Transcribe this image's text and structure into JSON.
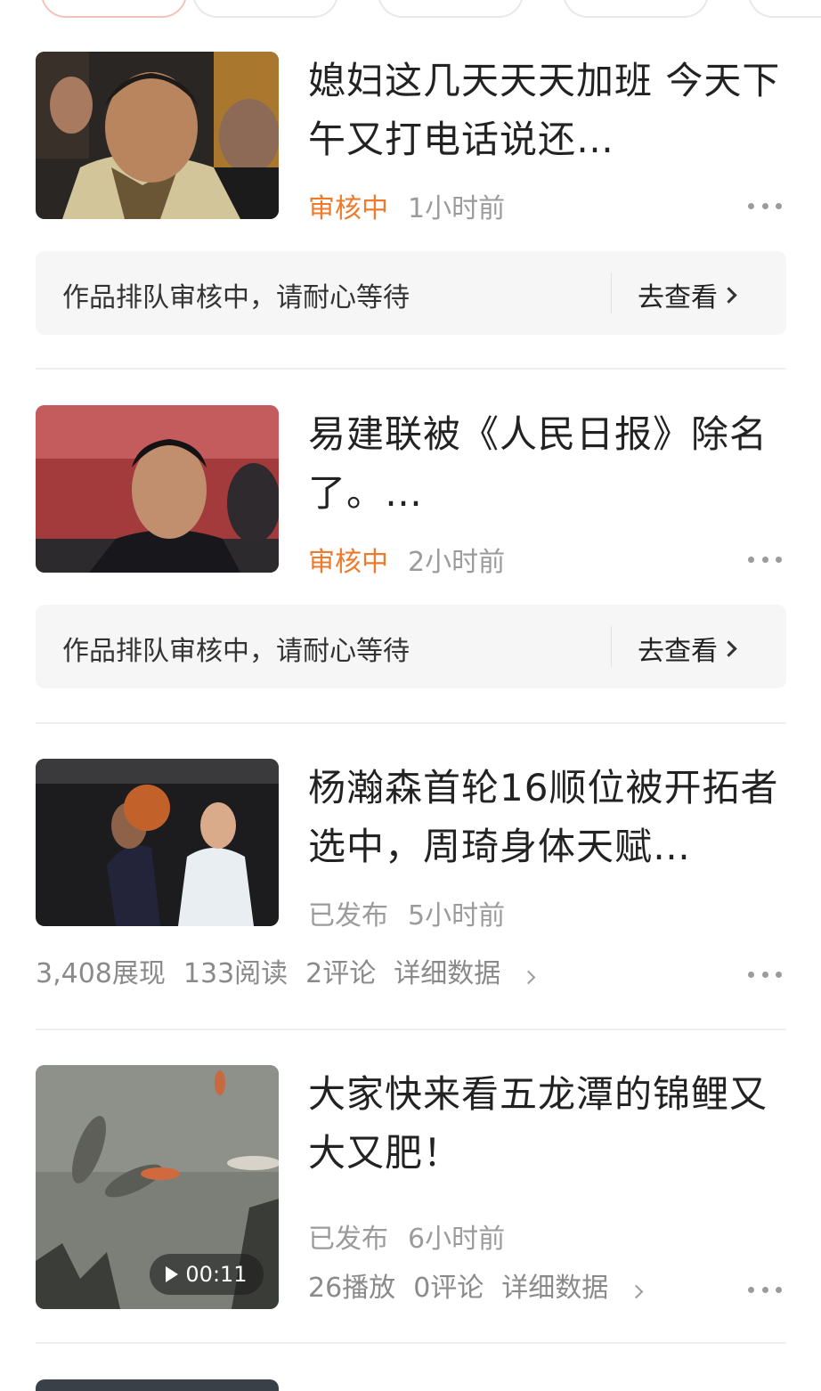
{
  "articles": [
    {
      "title": "媳妇这几天天天加班 今天下午又打电话说还…",
      "status": "审核中",
      "time": "1小时前",
      "notice": "作品排队审核中，请耐心等待",
      "notice_action": "去查看"
    },
    {
      "title": "易建联被《人民日报》除名了。…",
      "status": "审核中",
      "time": "2小时前",
      "notice": "作品排队审核中，请耐心等待",
      "notice_action": "去查看"
    },
    {
      "title": "杨瀚森首轮16顺位被开拓者选中，周琦身体天赋…",
      "status": "已发布",
      "time": "5小时前",
      "impressions": "3,408展现",
      "reads": "133阅读",
      "comments": "2评论",
      "detail": "详细数据"
    },
    {
      "title": "大家快来看五龙潭的锦鲤又大又肥！",
      "status": "已发布",
      "time": "6小时前",
      "duration": "00:11",
      "plays": "26播放",
      "comments": "0评论",
      "detail": "详细数据"
    }
  ],
  "colors": {
    "status_review": "#ee7a2c",
    "status_published": "#9b9b9b"
  }
}
